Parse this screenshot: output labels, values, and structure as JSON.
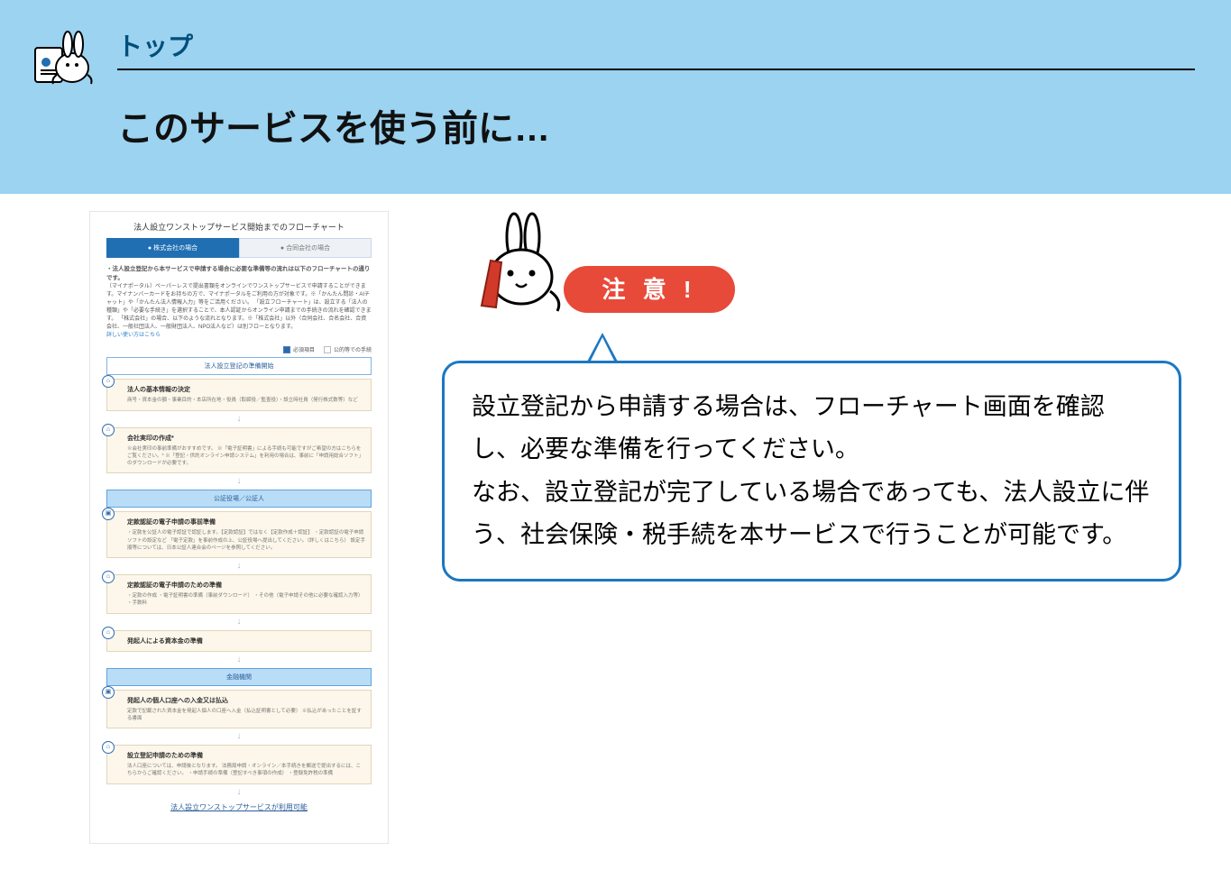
{
  "header": {
    "top_label": "トップ",
    "title": "このサービスを使う前に…"
  },
  "screenshot": {
    "title": "法人設立ワンストップサービス開始までのフローチャート",
    "tab_active": "● 株式会社の場合",
    "tab_inactive": "● 合同会社の場合",
    "intro_bold": "・法人設立登記から本サービスで申請する場合に必要な準備等の流れは以下のフローチャートの通りです。",
    "intro_body": "〔マイナポータル〕ペーパーレスで提出書類をオンラインでワンストップサービスで申請することができます。マイナンバーカードをお持ちの方で、マイナポータルをご利用の方が対象です。※「かんたん問診・AIチャット」や「かんたん法人情報入力」等をご活用ください。\n「設立フローチャート」は、設立する「法人の種類」や「必要な手続き」を選択することで、本人認証からオンライン申請までの手続きの流れを確認できます。\n「株式会社」の場合、以下のような流れとなります。※「株式会社」以外（合同会社、合名会社、合資会社、一般社団法人、一般財団法人、NPO法人など）は別フローとなります。",
    "intro_link": "詳しい使い方はこちら",
    "legend_on": "必須項目",
    "legend_off": "公的等での手続",
    "section_start": "法人設立登記の準備開始",
    "step1_title": "法人の基本情報の決定",
    "step1_body": "商号・資本金の額・事業目的・本店所在地・役員（取締役／監査役）・設立時社員（発行株式数等）など",
    "step2_title": "会社実印の作成*",
    "step2_body": "※会社実印の事前準備がおすすめです。\n※「電子証明書」による手続も可能ですがご希望の方はこちらをご覧ください。*\n※「登記・供託オンライン申請システム」を利用の場合は、事前に「申請用総合ソフト」のダウンロードが必要です。",
    "section_notary": "公証役場／公証人",
    "step3_title": "定款認証の電子申請の事前準備",
    "step3_body": "・定款を公証人の電子認証で認証します。【定款認証】ではなく【定款作成＋認証】\n・定款認証の電子申請ソフトの設定など\n「電子定款」を事前作成の上、公証役場へ提出してください。（詳しくはこちら）\n設定手順等については、日本公証人連合会のページを参照してください。",
    "step4_title": "定款認証の電子申請のための準備",
    "step4_body": "・定款の作成\n・電子証明書の準備（事前ダウンロード）\n・その他（電子申請その他に必要な確認入力等）\n・手数料",
    "step5_title": "発起人による資本金の準備",
    "section_bank": "金融機関",
    "step6_title": "発起人の個人口座への入金又は払込",
    "step6_body": "定款で記載された資本金を発起人個人の口座へ入金（払込証明書として必要）\n※払込があったことを証する書面",
    "step7_title": "設立登記申請のための準備",
    "step7_body": "法人口座については、申請後となります。\n法務局申請・オンライン／本手続きを郵送で提出するには、こちらからご確認ください。\n・申請手続の準備（登記すべき事項の作成）\n・登録免許税の準備",
    "final": "法人設立ワンストップサービスが利用可能"
  },
  "warning": {
    "label": "注 意 !"
  },
  "speech": {
    "text": "設立登記から申請する場合は、フローチャート画面を確認し、必要な準備を行ってください。\nなお、設立登記が完了している場合であっても、法人設立に伴う、社会保険・税手続を本サービスで行うことが可能です。"
  }
}
